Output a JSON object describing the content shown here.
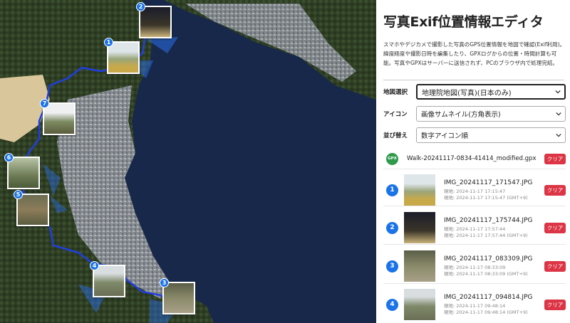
{
  "app": {
    "title": "写真Exif位置情報エディタ",
    "description": "スマホやデジカメで撮影した写真のGPS位置情報を地図で確認(Exif利用)。緯度経度や撮影日時を編集したり、GPXログからの位置・時間計算も可能。写真やGPXはサーバーに送信されず、PCのブラウザ内で処理完結。"
  },
  "controls": {
    "map_select": {
      "label": "地図選択",
      "value": "地理院地図(写真)(日本のみ)"
    },
    "icon_select": {
      "label": "アイコン",
      "value": "画像サムネイル(方角表示)"
    },
    "sort_select": {
      "label": "並び替え",
      "value": "数字アイコン順"
    }
  },
  "gpx": {
    "icon_text": "GPX",
    "filename": "Walk-20241117-0834-41414_modified.gpx",
    "clear_label": "クリア"
  },
  "photos": [
    {
      "num": "1",
      "filename": "IMG_20241117_171547.JPG",
      "current": "現地: 2024-11-17 17:15:47",
      "converted": "現地: 2024-11-17 17:15:47 (GMT+9)",
      "clear_label": "クリア"
    },
    {
      "num": "2",
      "filename": "IMG_20241117_175744.JPG",
      "current": "現地: 2024-11-17 17:57:44",
      "converted": "現地: 2024-11-17 17:57:44 (GMT+9)",
      "clear_label": "クリア"
    },
    {
      "num": "3",
      "filename": "IMG_20241117_083309.JPG",
      "current": "現地: 2024-11-17 08:33:09",
      "converted": "現地: 2024-11-17 08:33:09 (GMT+9)",
      "clear_label": "クリア"
    },
    {
      "num": "4",
      "filename": "IMG_20241117_094814.JPG",
      "current": "現地: 2024-11-17 09:48:14",
      "converted": "現地: 2024-11-17 09:48:14 (GMT+9)",
      "clear_label": "クリア"
    }
  ],
  "map_markers": [
    {
      "num": "2"
    },
    {
      "num": "1"
    },
    {
      "num": "7"
    },
    {
      "num": "6"
    },
    {
      "num": "5"
    },
    {
      "num": "4"
    },
    {
      "num": "3"
    }
  ],
  "icons": {
    "select_chevron": "chevron-down-icon"
  },
  "colors": {
    "track": "#1f3fe0",
    "badge": "#1a73e8",
    "clear": "#dc3545",
    "gpx": "#2e9a4a",
    "sea": "#17284a"
  }
}
